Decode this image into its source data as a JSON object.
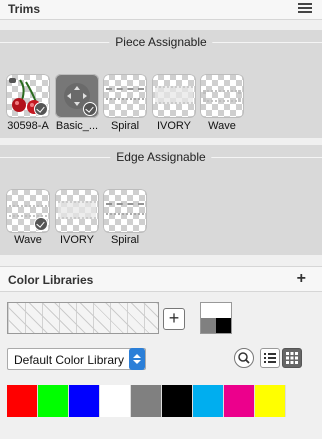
{
  "trims": {
    "title": "Trims",
    "menu_icon": "hamburger-menu-icon",
    "piece_assignable": {
      "label": "Piece Assignable",
      "items": [
        {
          "label": "30598-A",
          "kind": "image-cherries"
        },
        {
          "label": "Basic_...",
          "kind": "button-dark"
        },
        {
          "label": "Spiral",
          "kind": "trim"
        },
        {
          "label": "IVORY",
          "kind": "trim"
        },
        {
          "label": "Wave",
          "kind": "trim"
        }
      ]
    },
    "edge_assignable": {
      "label": "Edge Assignable",
      "items": [
        {
          "label": "Wave",
          "kind": "trim"
        },
        {
          "label": "IVORY",
          "kind": "trim"
        },
        {
          "label": "Spiral",
          "kind": "trim"
        }
      ]
    }
  },
  "color_libraries": {
    "title": "Color Libraries",
    "add_symbol": "+",
    "pattern_add_symbol": "+",
    "dropdown": {
      "selected": "Default Color Library"
    },
    "tools": [
      "search-icon",
      "list-view-icon",
      "grid-view-icon"
    ],
    "swatches": [
      "#ff0000",
      "#00ff00",
      "#0000ff",
      "#ffffff",
      "#808080",
      "#000000",
      "#00aeef",
      "#ec008c",
      "#ffff00"
    ],
    "default_colors": [
      "#ffffff",
      "#ffffff",
      "#808080",
      "#000000"
    ]
  }
}
